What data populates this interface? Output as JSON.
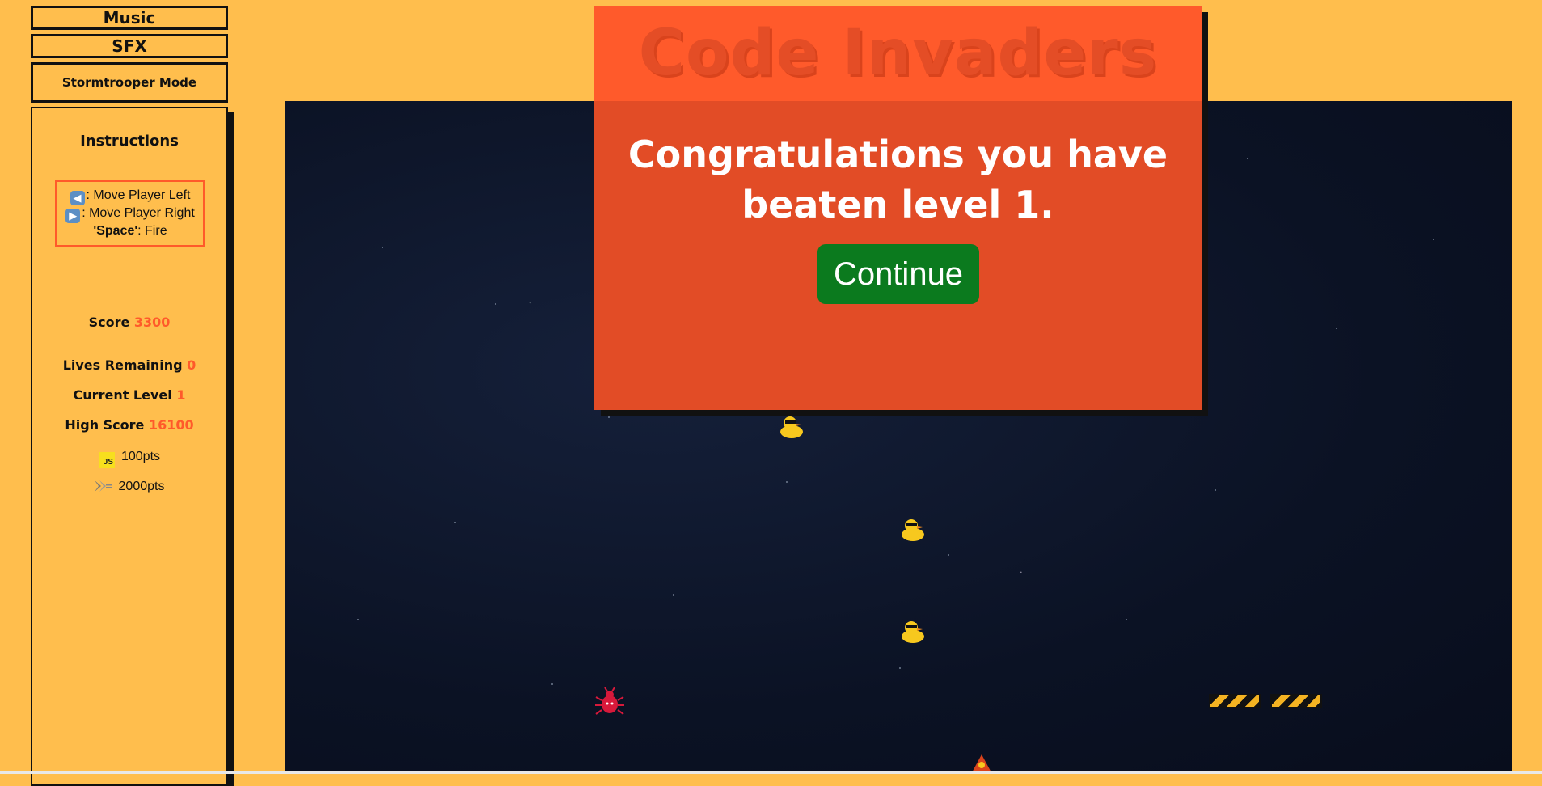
{
  "controls": {
    "music_label": "Music",
    "sfx_label": "SFX",
    "stormtrooper_label": "Stormtrooper Mode"
  },
  "instructions": {
    "title": "Instructions",
    "left_key_icon": "⬅️",
    "left_text": ": Move Player Left",
    "right_key_icon": "➡️",
    "right_text": ": Move Player Right",
    "space_key": "'Space'",
    "space_text": ": Fire"
  },
  "stats": {
    "score_label": "Score",
    "score_value": "3300",
    "lives_label": "Lives Remaining",
    "lives_value": "0",
    "level_label": "Current Level",
    "level_value": "1",
    "high_score_label": "High Score",
    "high_score_value": "16100",
    "js_points": "100pts",
    "js_icon_text": "JS",
    "ship_points": "2000pts"
  },
  "game": {
    "title": "Code Invaders",
    "modal_message": "Congratulations you have beaten level 1.",
    "continue_label": "Continue"
  },
  "colors": {
    "background": "#FFBE4D",
    "accent": "#FF5A2A",
    "modal": "#E24C26",
    "continue": "#0B7A1E",
    "space": "#0B1224"
  }
}
